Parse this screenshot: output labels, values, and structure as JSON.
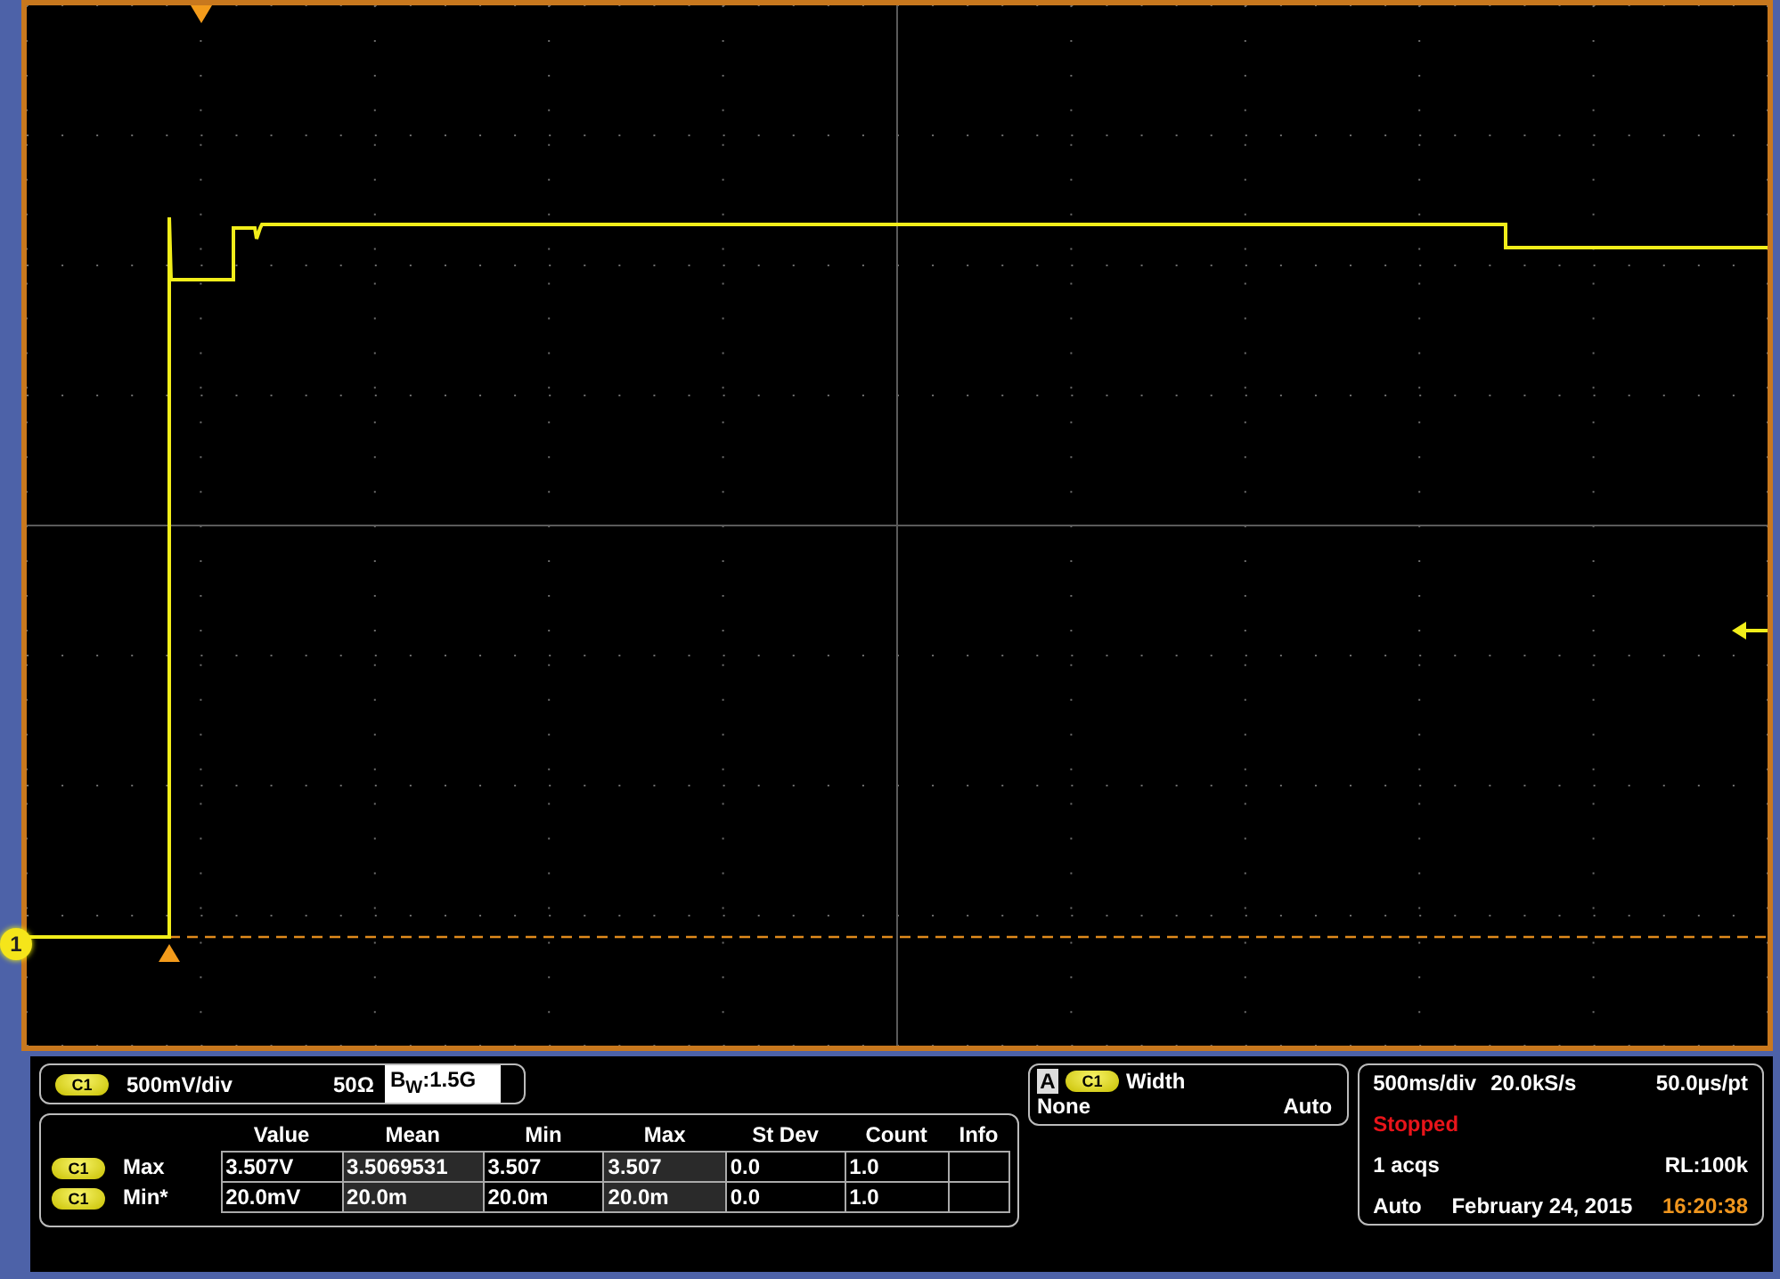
{
  "screen": {
    "channel_marker": "1"
  },
  "channel_readout": {
    "badge": "C1",
    "scale": "500mV/div",
    "impedance": "50Ω",
    "bandwidth": "B$_{W}$:1.5G"
  },
  "measurements": {
    "columns": [
      "Value",
      "Mean",
      "Min",
      "Max",
      "St Dev",
      "Count",
      "Info"
    ],
    "rows": [
      {
        "badge": "C1",
        "name": "Max",
        "cells": [
          "3.507V",
          "3.5069531",
          "3.507",
          "3.507",
          "0.0",
          "1.0"
        ]
      },
      {
        "badge": "C1",
        "name": "Min*",
        "cells": [
          "20.0mV",
          "20.0m",
          "20.0m",
          "20.0m",
          "0.0",
          "1.0"
        ]
      }
    ]
  },
  "trigger": {
    "source": "A",
    "badge": "C1",
    "type": "Width",
    "coupling": "None",
    "mode": "Auto"
  },
  "acquisition": {
    "horizontal_scale": "500ms/div",
    "sample_rate": "20.0kS/s",
    "resolution": "50.0µs/pt",
    "state": "Stopped",
    "acquisitions": "1 acqs",
    "record_length": "RL:100k",
    "trigger_mode": "Auto",
    "date": "February 24, 2015",
    "time": "16:20:38"
  }
}
